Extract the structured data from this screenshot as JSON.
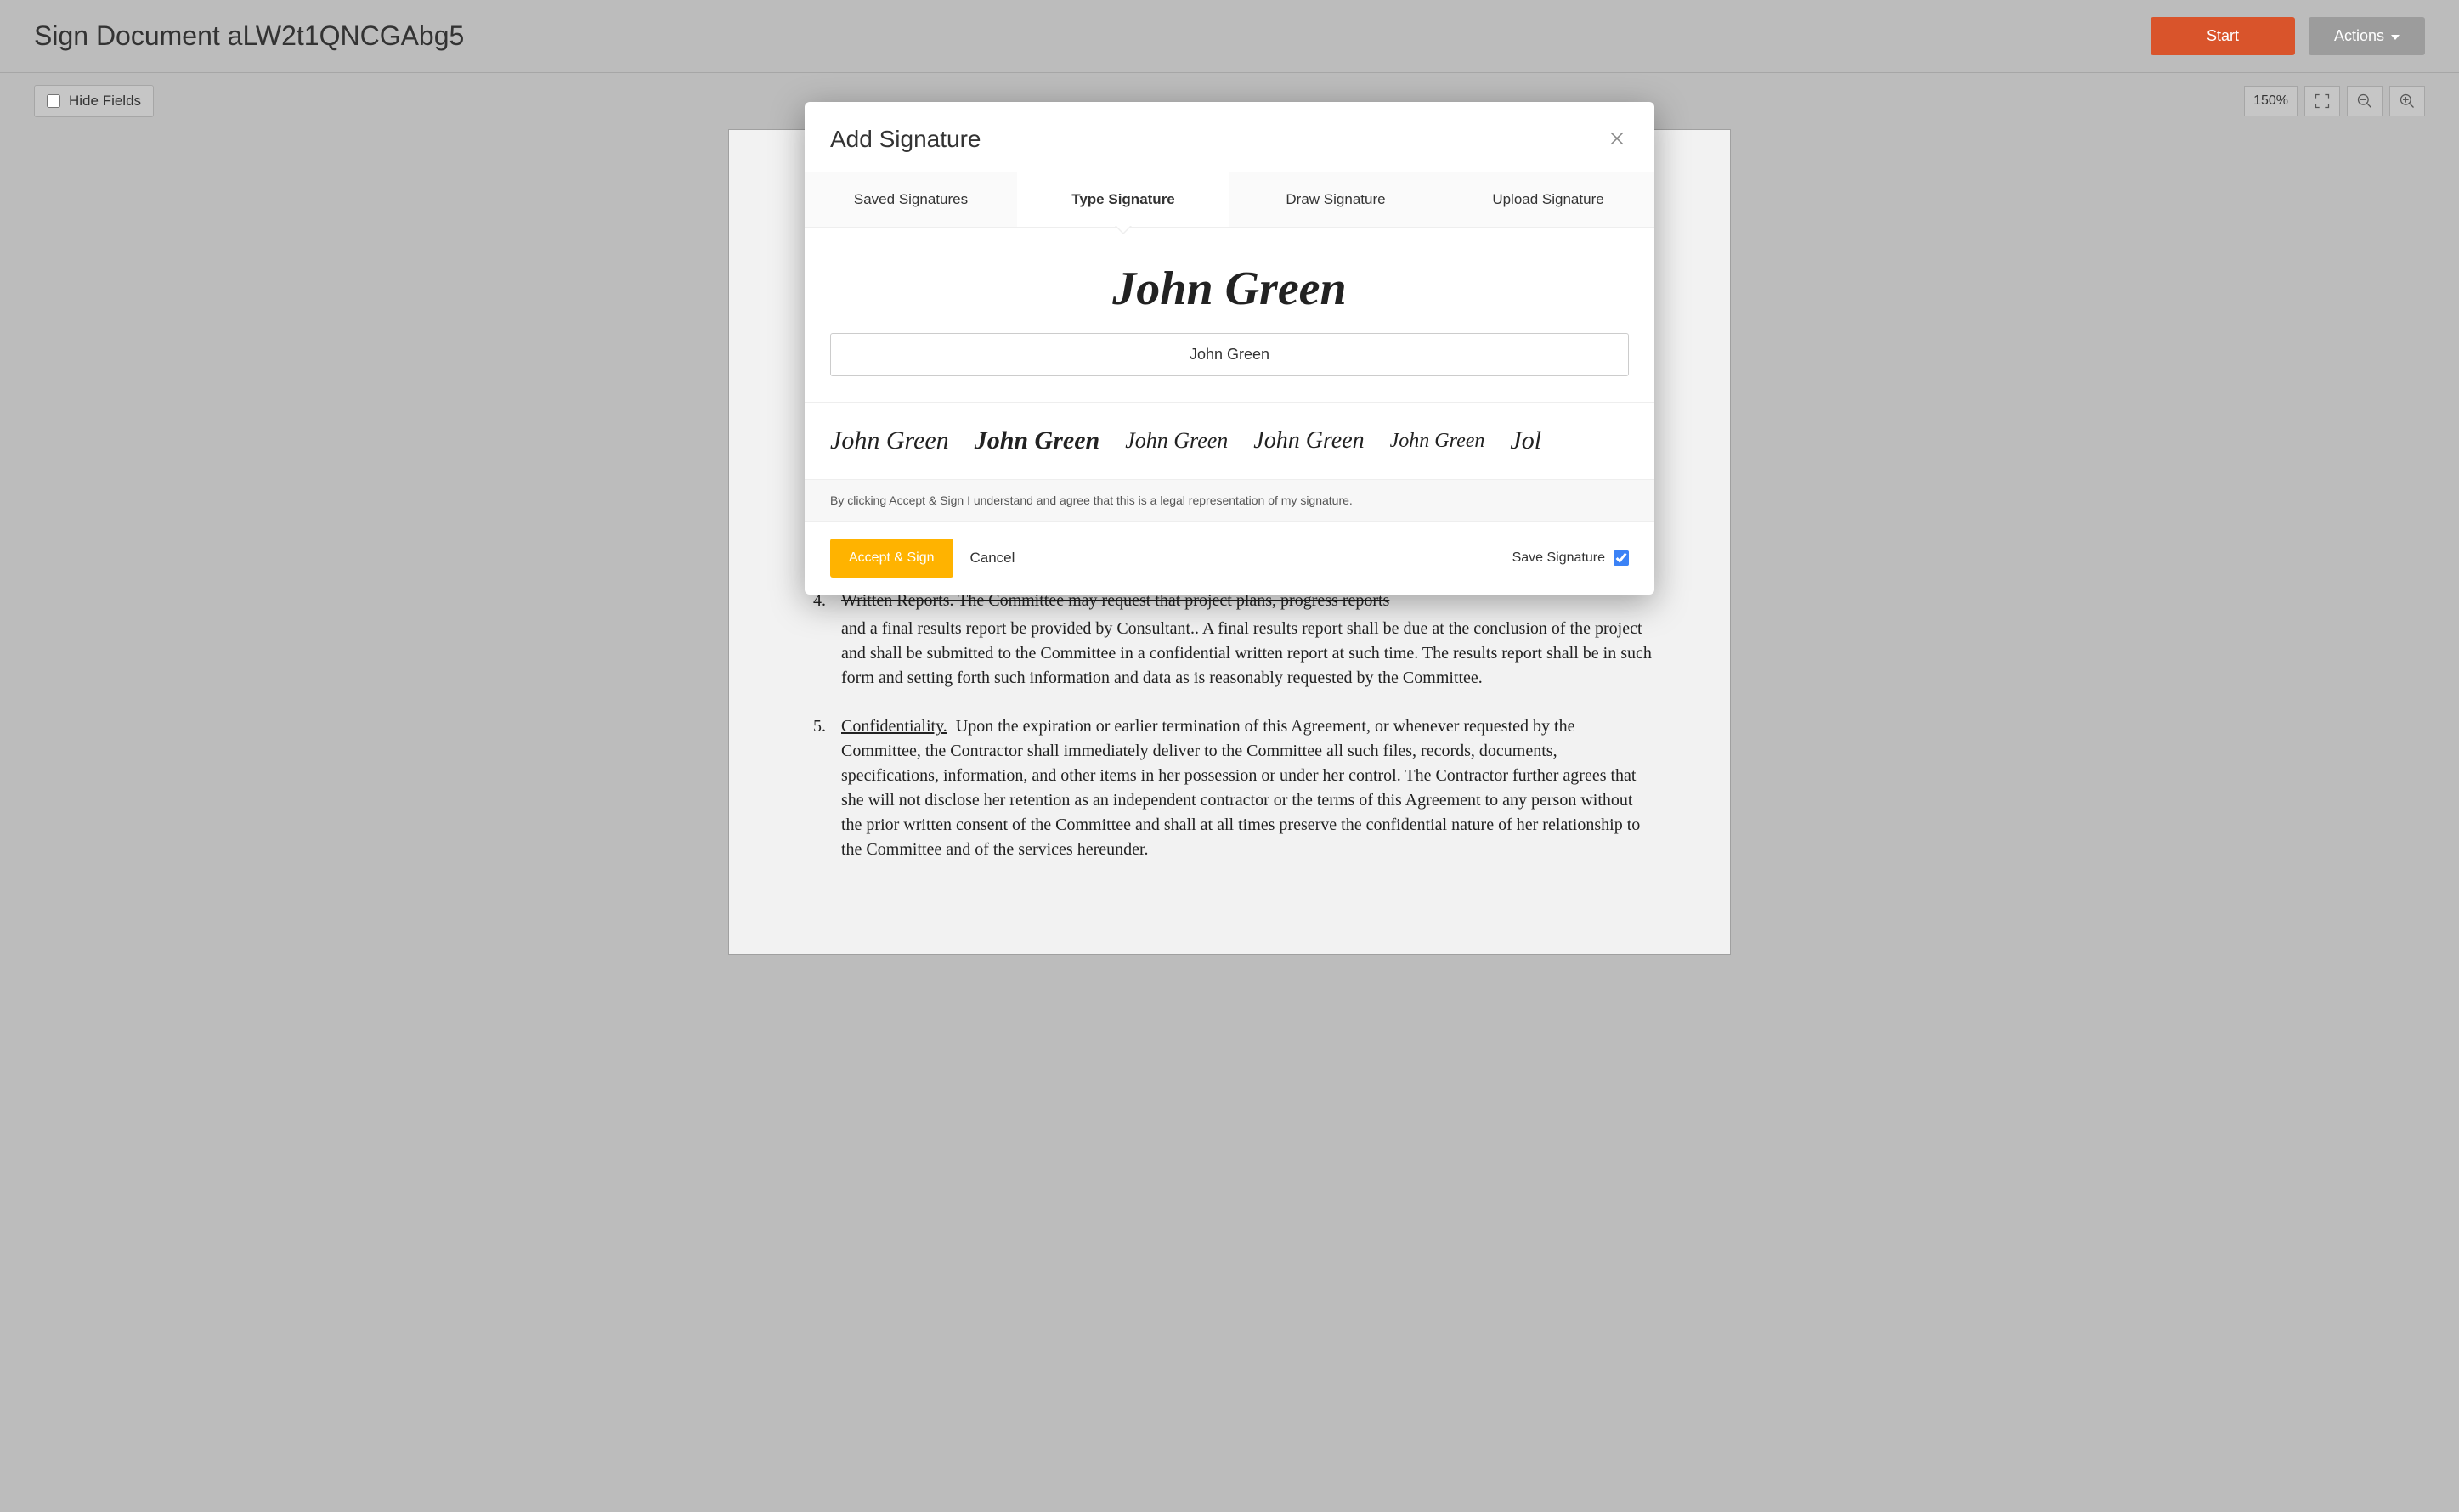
{
  "header": {
    "title": "Sign Document aLW2t1QNCGAbg5",
    "start_label": "Start",
    "actions_label": "Actions"
  },
  "toolbar": {
    "hide_fields_label": "Hide Fields",
    "zoom_label": "150%"
  },
  "modal": {
    "title": "Add Signature",
    "tabs": [
      {
        "label": "Saved Signatures",
        "active": false
      },
      {
        "label": "Type Signature",
        "active": true
      },
      {
        "label": "Draw Signature",
        "active": false
      },
      {
        "label": "Upload Signature",
        "active": false
      }
    ],
    "preview_name": "John Green",
    "input_value": "John Green",
    "styles": [
      "John Green",
      "John Green",
      "John Green",
      "John Green",
      "John Green",
      "Jol"
    ],
    "disclaimer": "By clicking Accept & Sign I understand and agree that this is a legal representation of my signature.",
    "accept_label": "Accept & Sign",
    "cancel_label": "Cancel",
    "save_label": "Save Signature",
    "save_checked": true
  },
  "document": {
    "items": [
      {
        "num": "4.",
        "title": "Written Reports.",
        "strike_lead": "Written Reports.  The Committee may request that project plans, progress reports",
        "body": "and a final results report be provided by Consultant..  A final results report shall be due at the conclusion of the project and shall be submitted to the Committee in a confidential written report at such time. The results report shall be in such form and setting forth such information and data as is reasonably requested by the Committee."
      },
      {
        "num": "5.",
        "title": "Confidentiality.",
        "body": "Upon the expiration or earlier termination of this Agreement, or whenever requested by the Committee, the Contractor shall immediately deliver to the Committee all such files, records, documents, specifications, information, and other items in her possession or under her control.  The Contractor further agrees that she will not disclose her retention as an independent contractor or the terms of this Agreement to any person without the prior written consent of the Committee and shall at all times preserve the confidential nature of her relationship to the Committee and of the services hereunder."
      }
    ]
  }
}
